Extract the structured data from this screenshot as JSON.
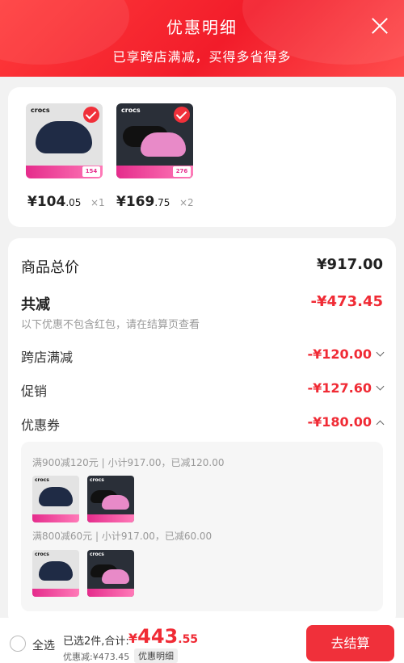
{
  "header": {
    "title": "优惠明细",
    "subtitle": "已享跨店满减，买得多省得多"
  },
  "products": [
    {
      "brand": "crocs",
      "price_int": "¥104",
      "price_dec": ".05",
      "qty": "×1",
      "tag": "154",
      "selected": true
    },
    {
      "brand": "crocs",
      "price_int": "¥169",
      "price_dec": ".75",
      "qty": "×2",
      "tag": "276",
      "selected": true
    }
  ],
  "summary": {
    "total_label": "商品总价",
    "total_value": "¥917.00",
    "reduce_label": "共减",
    "reduce_value": "-¥473.45",
    "note": "以下优惠不包含红包，请在结算页查看",
    "discounts": [
      {
        "label": "跨店满减",
        "value": "-¥120.00",
        "expanded": false
      },
      {
        "label": "促销",
        "value": "-¥127.60",
        "expanded": false
      },
      {
        "label": "优惠券",
        "value": "-¥180.00",
        "expanded": true
      }
    ]
  },
  "coupon_details": [
    {
      "text": "满900减120元 | 小计917.00，已减120.00",
      "items": [
        "crocs",
        "crocs"
      ]
    },
    {
      "text": "满800减60元 | 小计917.00，已减60.00",
      "items": [
        "crocs",
        "crocs"
      ]
    }
  ],
  "bottom_bar": {
    "select_all": "全选",
    "selected_info": "已选2件,合计:",
    "amount_currency": "¥",
    "amount_int": "443",
    "amount_dec": ".55",
    "saved": "优惠减:¥473.45",
    "detail_button": "优惠明细",
    "checkout_button": "去结算"
  },
  "colors": {
    "accent": "#f02b35",
    "header_bg": "#f21c2a",
    "page_bg": "#f2f2f2"
  }
}
